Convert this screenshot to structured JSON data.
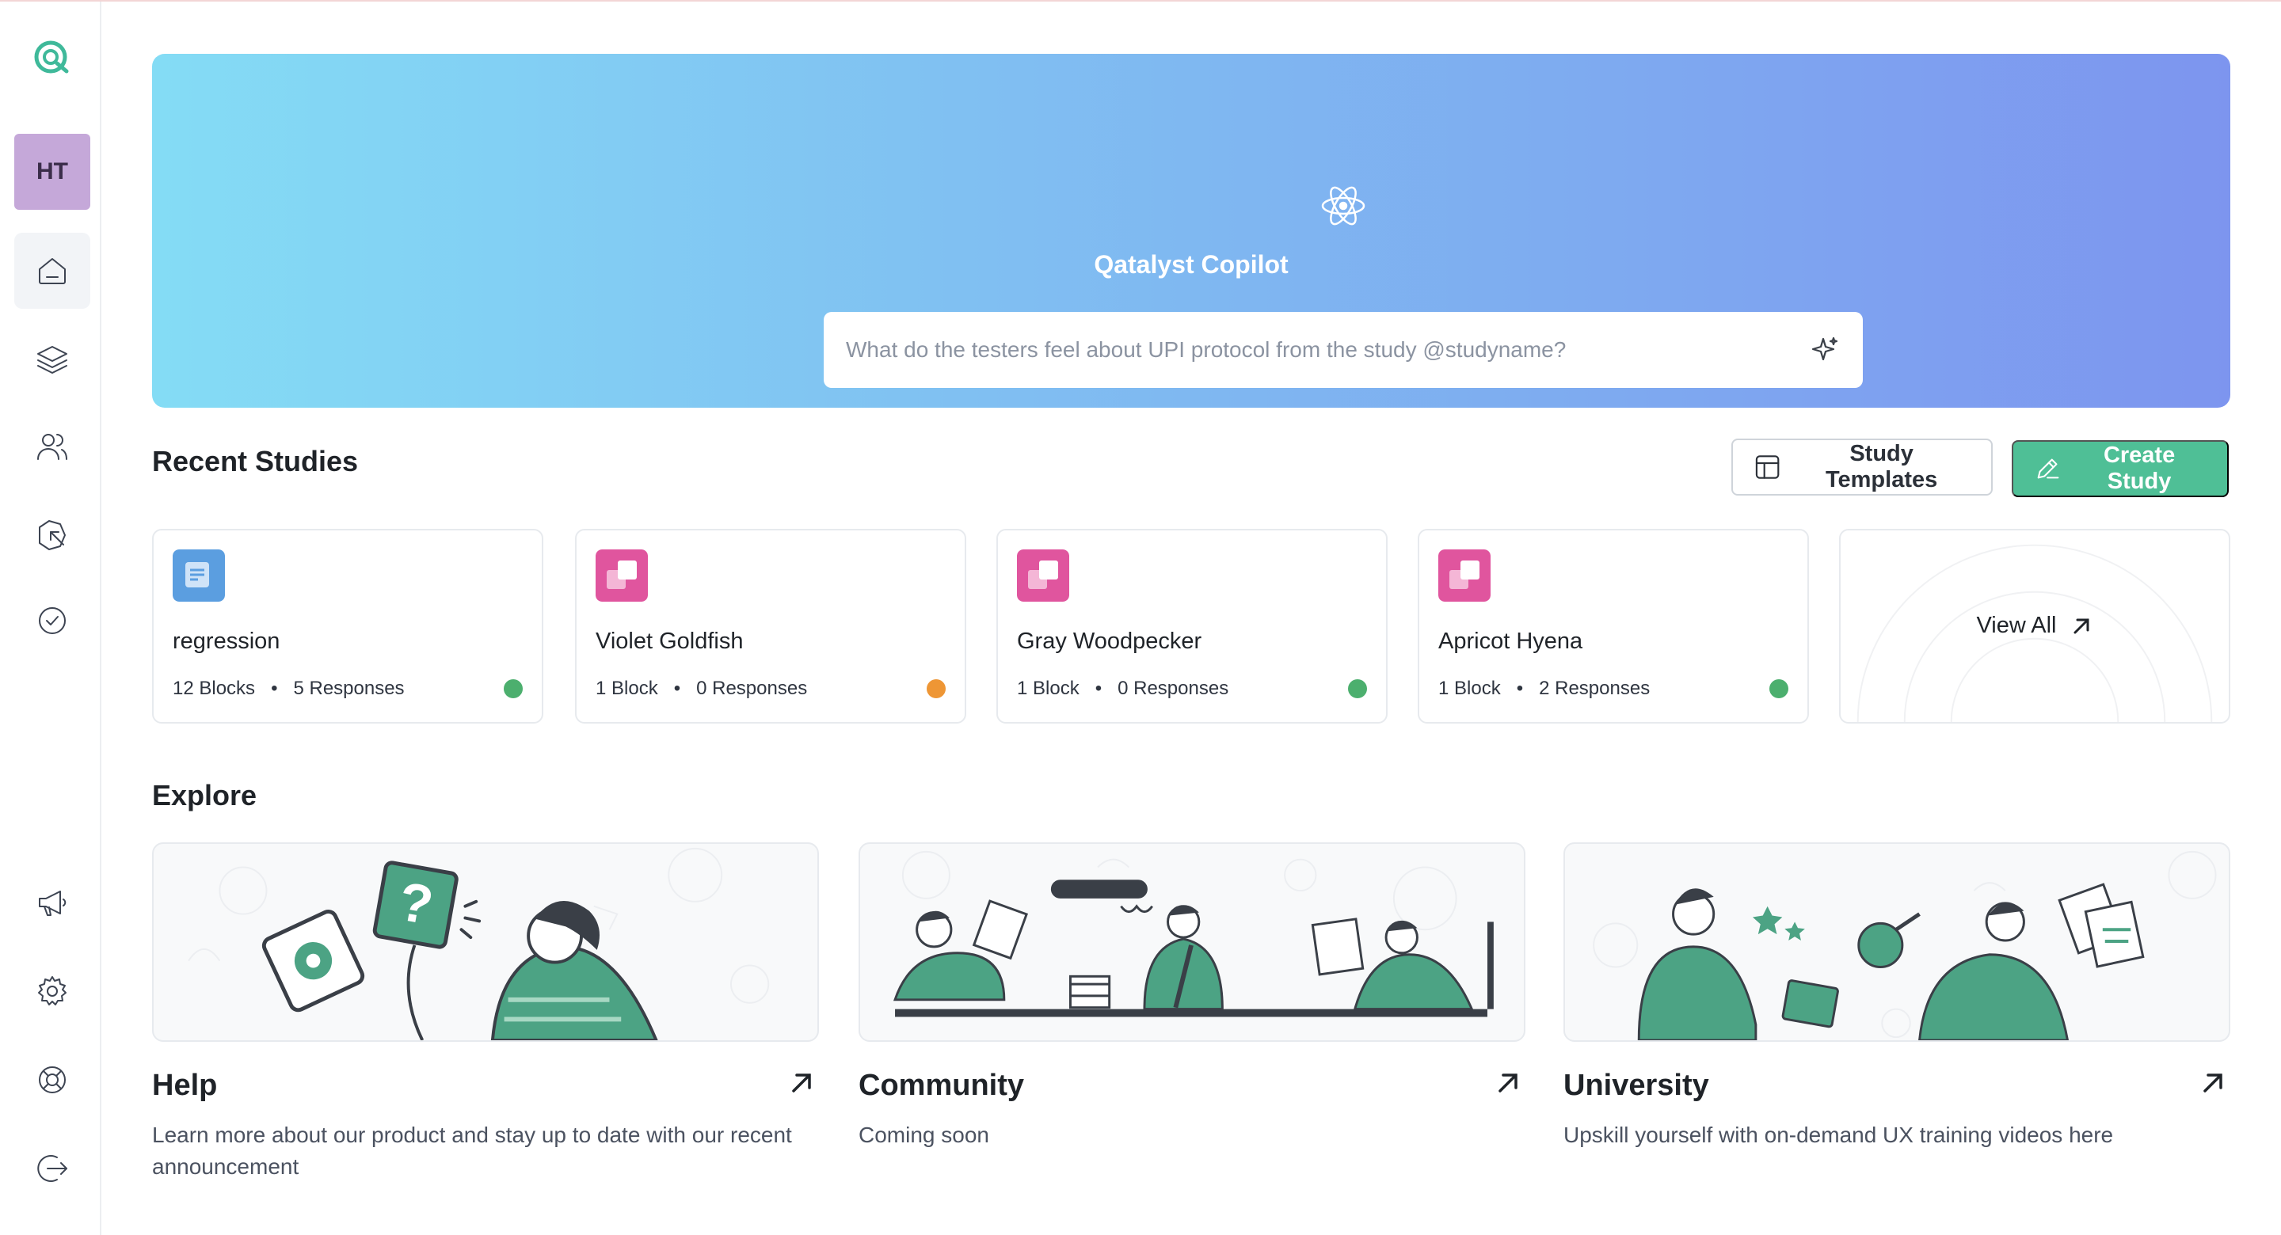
{
  "sidebar": {
    "avatar_initials": "HT",
    "top_items": [
      "home-icon",
      "layers-icon",
      "users-icon",
      "cursor-click-icon",
      "badge-check-icon"
    ],
    "bottom_items": [
      "megaphone-icon",
      "gear-icon",
      "lifebuoy-icon",
      "logout-icon"
    ]
  },
  "hero": {
    "title": "Qatalyst Copilot",
    "search_placeholder": "What do the testers feel about UPI protocol from the study @studyname?"
  },
  "recent": {
    "title": "Recent Studies",
    "templates_label": "Study Templates",
    "create_label": "Create Study",
    "view_all_label": "View All",
    "studies": [
      {
        "name": "regression",
        "blocks": "12 Blocks",
        "responses": "5 Responses",
        "status_color": "#4caf6e",
        "icon_color": "#5b9ee0"
      },
      {
        "name": "Violet Goldfish",
        "blocks": "1 Block",
        "responses": "0 Responses",
        "status_color": "#ee9635",
        "icon_color": "#e0559e"
      },
      {
        "name": "Gray Woodpecker",
        "blocks": "1 Block",
        "responses": "0 Responses",
        "status_color": "#4caf6e",
        "icon_color": "#e0559e"
      },
      {
        "name": "Apricot Hyena",
        "blocks": "1 Block",
        "responses": "2 Responses",
        "status_color": "#4caf6e",
        "icon_color": "#e0559e"
      }
    ]
  },
  "explore": {
    "title": "Explore",
    "cards": [
      {
        "title": "Help",
        "desc": "Learn more about our product and stay up to date with our recent announcement"
      },
      {
        "title": "Community",
        "desc": "Coming soon"
      },
      {
        "title": "University",
        "desc": "Upskill yourself with on-demand UX training videos here"
      }
    ]
  },
  "colors": {
    "accent": "#4fbf96",
    "illustration_green": "#4ca384",
    "dark": "#3a3f47"
  }
}
